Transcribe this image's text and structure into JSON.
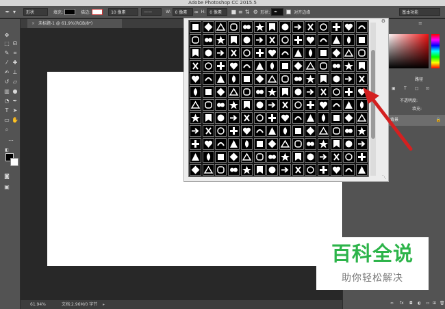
{
  "window": {
    "title": "Adobe Photoshop CC 2015.5"
  },
  "options_bar": {
    "mode": "形状",
    "fill_label": "填充:",
    "stroke_label": "描边:",
    "stroke_width": "10 像素",
    "width_label": "W:",
    "width_value": "0 像素",
    "height_label": "H:",
    "height_value": "0 像素",
    "shape_label": "形状:",
    "align_edges": "对齐边缘",
    "workspace": "基本功能"
  },
  "document": {
    "tab_title": "未标题-1 @ 61.9%(RGB/8*)",
    "zoom": "61.94%",
    "doc_info": "文档:2.96M/0 字节"
  },
  "panels": {
    "paths_tab": "路径",
    "opacity_label": "不透明度:",
    "fill_label": "填充:",
    "layer_name": "背景"
  },
  "watermark": {
    "title": "百科全说",
    "subtitle": "助你轻松解决"
  },
  "colors": {
    "accent_arrow": "#d42020",
    "watermark_green": "#2db44a"
  }
}
